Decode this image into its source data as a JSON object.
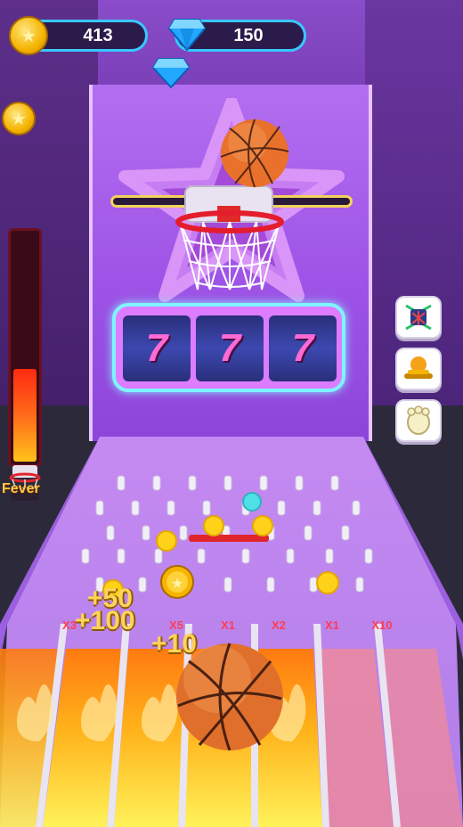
{
  "hud": {
    "coins": "413",
    "gems": "150"
  },
  "fever": {
    "label": "Fever",
    "level": 0.42
  },
  "slots": {
    "reels": [
      "7",
      "7",
      "7"
    ]
  },
  "multipliers": [
    "X3",
    "X5",
    "X1",
    "X2",
    "X1",
    "X10"
  ],
  "score_popups": [
    "+50",
    "+100",
    "+10"
  ],
  "side_buttons": [
    "net-icon",
    "coin-stack-icon",
    "glove-icon"
  ],
  "colors": {
    "hud_border": "#38c8ff",
    "backboard": "#a85cec",
    "slot_border": "#7ff3ff",
    "seven": "#ff6ad5",
    "multiplier": "#ff3d52",
    "popup": "#ffd35a"
  }
}
